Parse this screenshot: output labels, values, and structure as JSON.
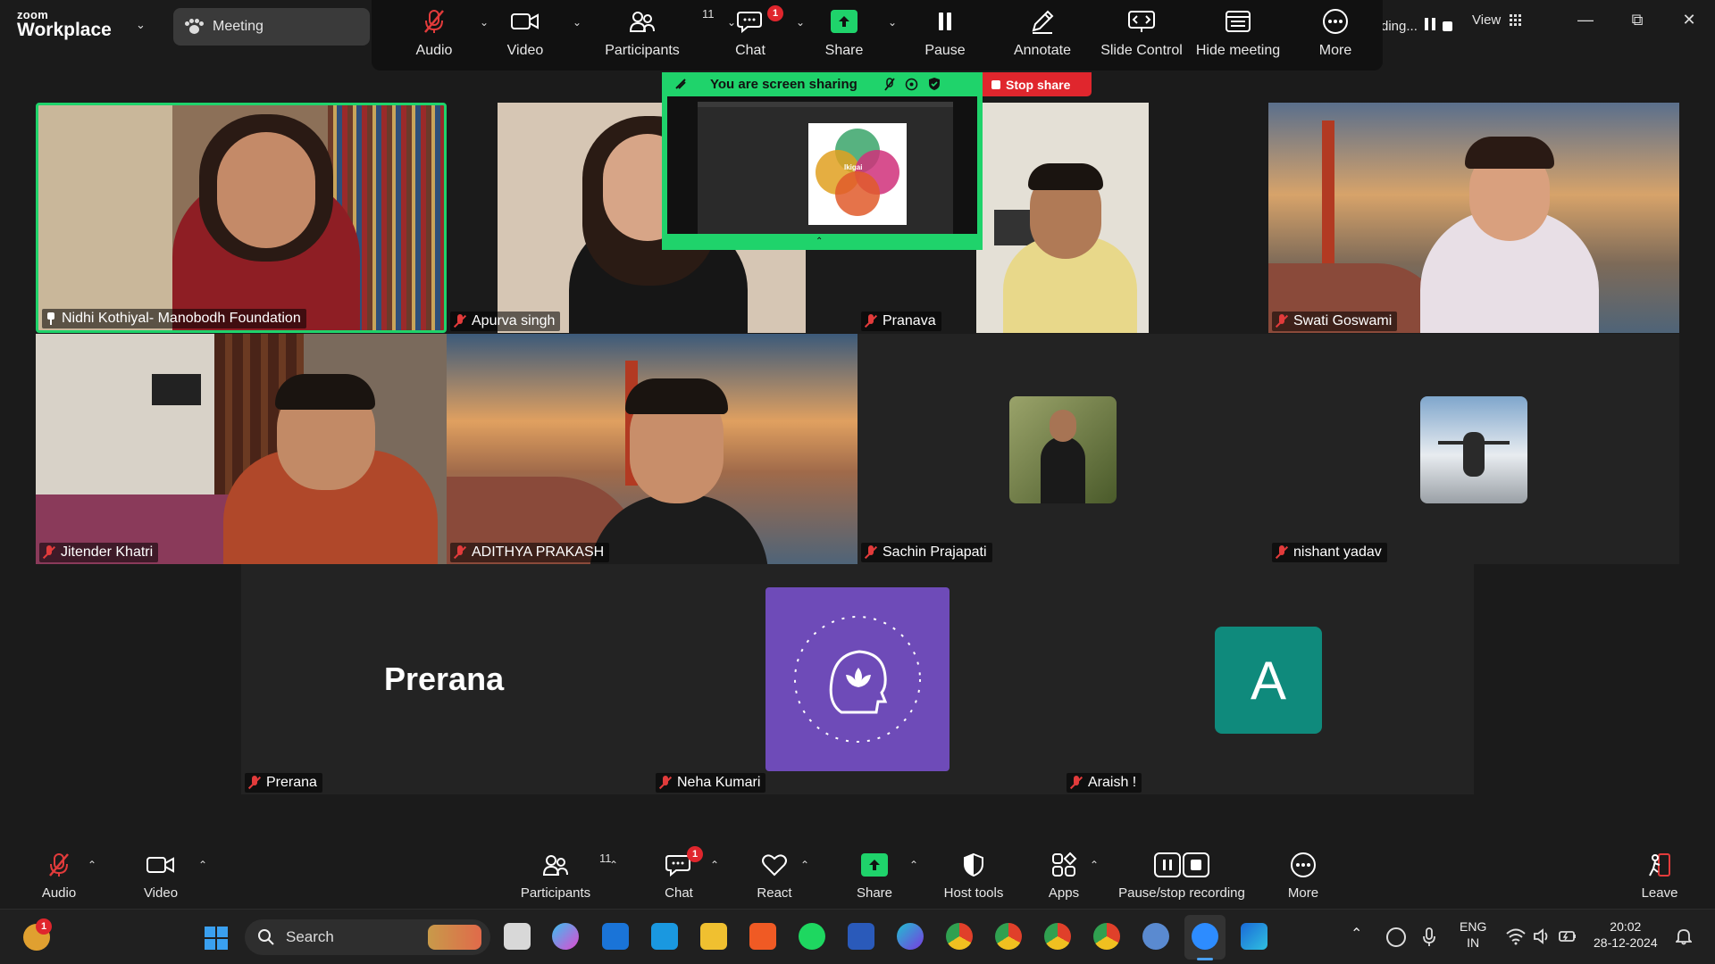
{
  "titlebar": {
    "logo_top": "zoom",
    "logo_bottom": "Workplace",
    "meeting_label": "Meeting",
    "recording_text": "ding...",
    "view_label": "View"
  },
  "toolbar": {
    "audio": "Audio",
    "video": "Video",
    "participants": "Participants",
    "participants_count": "11",
    "chat": "Chat",
    "chat_badge": "1",
    "share": "Share",
    "pause": "Pause",
    "annotate": "Annotate",
    "slide_control": "Slide Control",
    "hide_meeting": "Hide meeting",
    "more": "More"
  },
  "sharing": {
    "banner": "You are screen sharing",
    "stop": "Stop share",
    "slide_center": "Ikigai"
  },
  "participants": [
    {
      "name": "Nidhi Kothiyal- Manobodh Foundation",
      "pinned": true
    },
    {
      "name": "Apurva singh"
    },
    {
      "name": "Pranava"
    },
    {
      "name": "Swati Goswami"
    },
    {
      "name": "Jitender Khatri"
    },
    {
      "name": "ADITHYA PRAKASH"
    },
    {
      "name": "Sachin Prajapati"
    },
    {
      "name": "nishant yadav"
    },
    {
      "name": "Prerana",
      "display": "Prerana"
    },
    {
      "name": "Neha Kumari"
    },
    {
      "name": "Araish !",
      "avatar_letter": "A"
    }
  ],
  "bottombar": {
    "audio": "Audio",
    "video": "Video",
    "participants": "Participants",
    "participants_count": "11",
    "chat": "Chat",
    "chat_badge": "1",
    "react": "React",
    "share": "Share",
    "host_tools": "Host tools",
    "apps": "Apps",
    "record": "Pause/stop recording",
    "more": "More",
    "leave": "Leave"
  },
  "taskbar": {
    "search": "Search",
    "notif_badge": "1",
    "lang_top": "ENG",
    "lang_bottom": "IN",
    "time": "20:02",
    "date": "28-12-2024"
  },
  "colors": {
    "accent_green": "#1fd36b",
    "stop_red": "#e0262d",
    "mute_red": "#e23b3b",
    "avatar_teal": "#0f8a7c",
    "logo_purple": "#6e4bb8"
  }
}
